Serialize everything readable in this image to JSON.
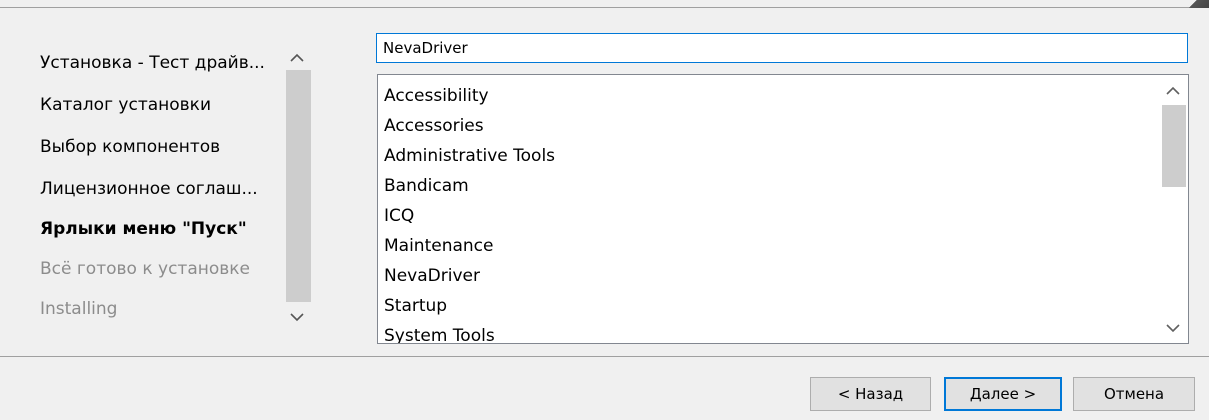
{
  "wizard_steps": [
    {
      "label": "Установка - Тест драйв...",
      "state": "normal"
    },
    {
      "label": "Каталог установки",
      "state": "normal"
    },
    {
      "label": "Выбор компонентов",
      "state": "normal"
    },
    {
      "label": "Лицензионное соглаш...",
      "state": "normal"
    },
    {
      "label": "Ярлыки меню \"Пуск\"",
      "state": "current"
    },
    {
      "label": "Всё готово к установке",
      "state": "disabled"
    },
    {
      "label": "Installing",
      "state": "disabled"
    }
  ],
  "folder_input": {
    "value": "NevaDriver"
  },
  "folder_list": [
    "Accessibility",
    "Accessories",
    "Administrative Tools",
    "Bandicam",
    "ICQ",
    "Maintenance",
    "NevaDriver",
    "Startup",
    "System Tools"
  ],
  "buttons": {
    "back": "< Назад",
    "next": "Далее >",
    "cancel": "Отмена"
  },
  "icons": {
    "scroll_up": "chevron-up-icon",
    "scroll_down": "chevron-down-icon"
  },
  "colors": {
    "accent": "#0078d7",
    "background": "#f0f0f0",
    "disabled_text": "#8c8c8c"
  }
}
